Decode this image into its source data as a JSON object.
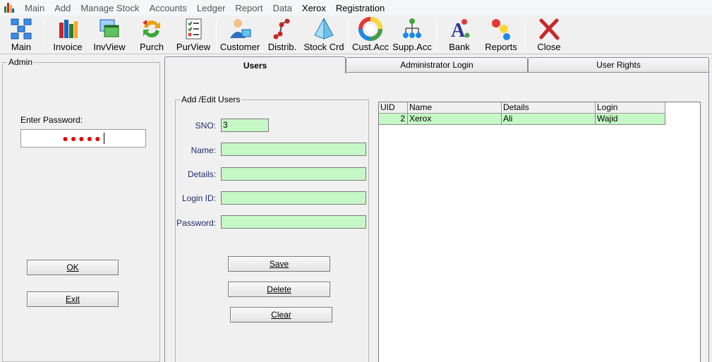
{
  "menubar": {
    "items": [
      "Main",
      "Add",
      "Manage Stock",
      "Accounts",
      "Ledger",
      "Report",
      "Data",
      "Xerox",
      "Registration"
    ]
  },
  "toolbar": {
    "main": "Main",
    "invoice": "Invoice",
    "invview": "InvView",
    "purch": "Purch",
    "purview": "PurView",
    "customer": "Customer",
    "distrib": "Distrib.",
    "stockcrd": "Stock Crd",
    "custacc": "Cust.Acc",
    "suppacc": "Supp.Acc",
    "bank": "Bank",
    "reports": "Reports",
    "close": "Close"
  },
  "admin": {
    "title": "Admin",
    "password_label": "Enter Password:",
    "password_value": "●●●●●",
    "ok_label": "OK",
    "exit_label": "Exit"
  },
  "tabs": [
    "Users",
    "Administrator Login",
    "User Rights"
  ],
  "edit": {
    "title": "Add /Edit Users",
    "sno_label": "SNO:",
    "sno_value": "3",
    "name_label": "Name:",
    "name_value": "",
    "details_label": "Details:",
    "details_value": "",
    "login_label": "Login ID:",
    "login_value": "",
    "password_label": "Password:",
    "password_value": "",
    "save_label": "Save",
    "delete_label": "Delete",
    "clear_label": "Clear"
  },
  "grid": {
    "headers": [
      "UID",
      "Name",
      "Details",
      "Login"
    ],
    "rows": [
      [
        "2",
        "Xerox",
        "Ali",
        "Wajid"
      ]
    ]
  },
  "colors": {
    "field_bg": "#c6f7c6",
    "password_dots": "#e00000",
    "label_text": "#1f2d6b"
  }
}
